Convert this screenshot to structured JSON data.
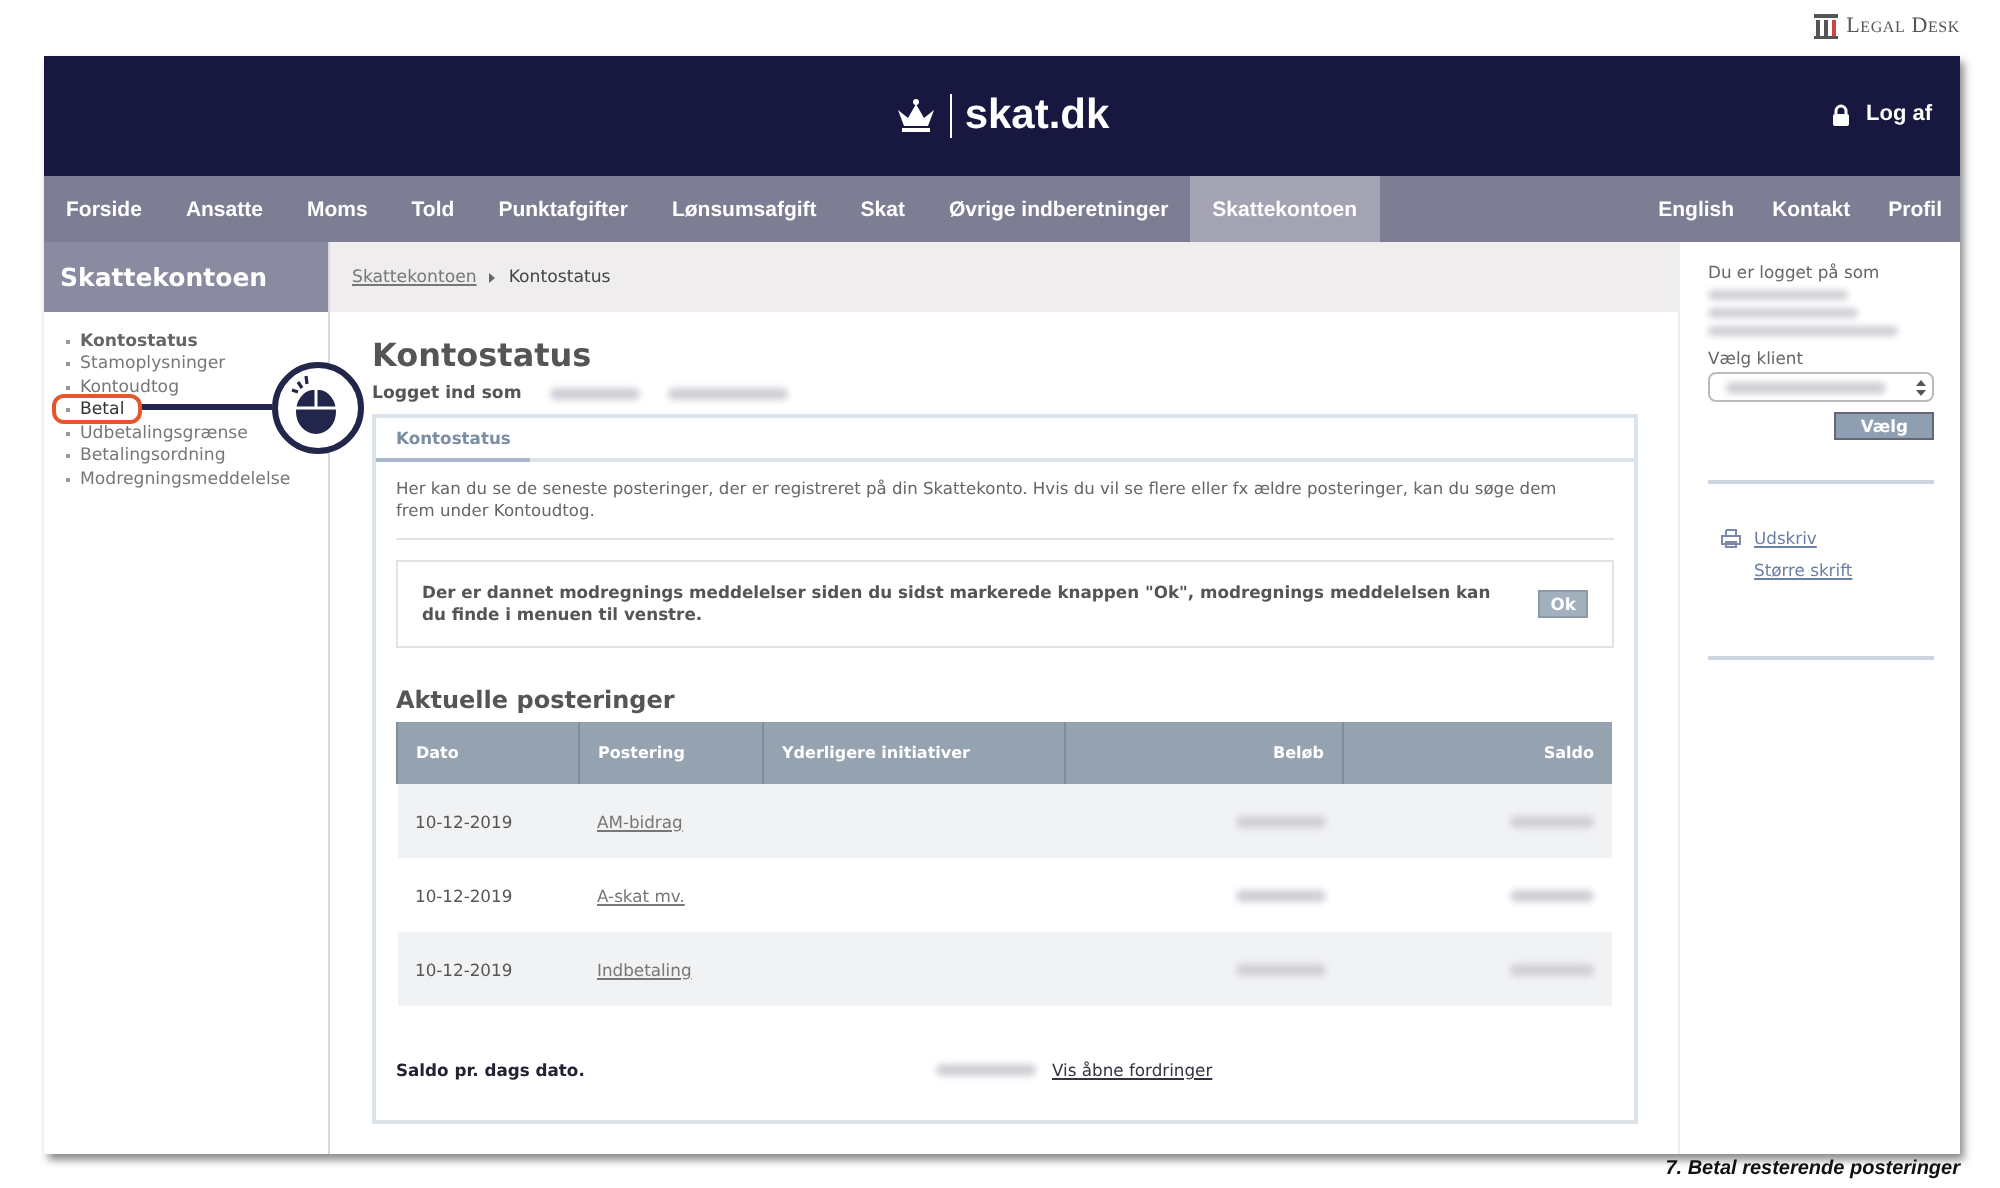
{
  "brand": {
    "logo": "Legal Desk"
  },
  "header": {
    "logo": "skat.dk",
    "logout": "Log af"
  },
  "nav": {
    "items": [
      {
        "label": "Forside",
        "selected": false
      },
      {
        "label": "Ansatte",
        "selected": false
      },
      {
        "label": "Moms",
        "selected": false
      },
      {
        "label": "Told",
        "selected": false
      },
      {
        "label": "Punktafgifter",
        "selected": false
      },
      {
        "label": "Lønsumsafgift",
        "selected": false
      },
      {
        "label": "Skat",
        "selected": false
      },
      {
        "label": "Øvrige indberetninger",
        "selected": false
      },
      {
        "label": "Skattekontoen",
        "selected": true
      }
    ],
    "right_items": [
      "English",
      "Kontakt",
      "Profil"
    ]
  },
  "sidebar": {
    "title": "Skattekontoen",
    "items": [
      {
        "label": "Kontostatus",
        "selected": true,
        "highlighted": false
      },
      {
        "label": "Stamoplysninger",
        "selected": false,
        "highlighted": false
      },
      {
        "label": "Kontoudtog",
        "selected": false,
        "highlighted": false
      },
      {
        "label": "Betal",
        "selected": false,
        "highlighted": true
      },
      {
        "label": "Udbetalingsgrænse",
        "selected": false,
        "highlighted": false
      },
      {
        "label": "Betalingsordning",
        "selected": false,
        "highlighted": false
      },
      {
        "label": "Modregningsmeddelelse",
        "selected": false,
        "highlighted": false
      }
    ]
  },
  "breadcrumb": [
    {
      "label": "Skattekontoen",
      "kind": "link"
    },
    {
      "label": "Kontostatus",
      "kind": "current"
    }
  ],
  "page": {
    "title": "Kontostatus",
    "logged_in_label": "Logget ind som"
  },
  "tabs": [
    {
      "label": "Kontostatus",
      "selected": true
    }
  ],
  "intro": "Her kan du se de seneste posteringer, der er registreret på din Skattekonto. Hvis du vil se flere eller fx ældre posteringer, kan du søge dem frem under Kontoudtog.",
  "notice": {
    "text": "Der er dannet modregnings meddelelser siden du sidst markerede knappen \"Ok\", modregnings meddelelsen kan du finde i menuen til venstre.",
    "button": "Ok"
  },
  "section_title": "Aktuelle posteringer",
  "table": {
    "columns": [
      "Dato",
      "Postering",
      "Yderligere initiativer",
      "Beløb",
      "Saldo"
    ],
    "rows": [
      {
        "dato": "10-12-2019",
        "postering": "AM-bidrag"
      },
      {
        "dato": "10-12-2019",
        "postering": "A-skat mv."
      },
      {
        "dato": "10-12-2019",
        "postering": "Indbetaling"
      }
    ]
  },
  "footer": {
    "saldo_label": "Saldo pr. dags dato.",
    "link": "Vis åbne fordringer"
  },
  "right_panel": {
    "logged_label": "Du er logget på som",
    "client_label": "Vælg klient",
    "choose_button": "Vælg",
    "links": [
      {
        "label": "Udskriv",
        "kind": "print"
      },
      {
        "label": "Større skrift",
        "kind": "plain"
      }
    ]
  },
  "caption": "7. Betal resterende posteringer"
}
